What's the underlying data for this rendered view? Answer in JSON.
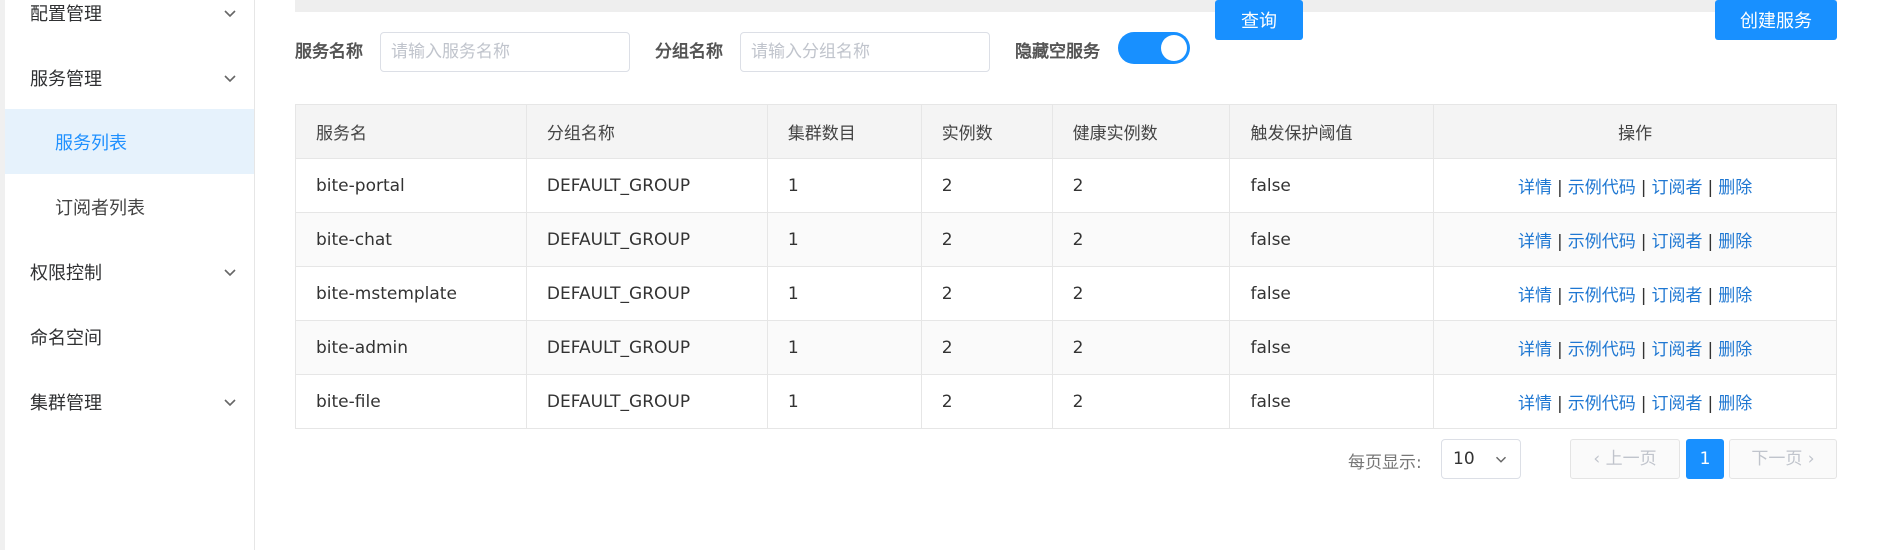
{
  "sidebar": {
    "items": [
      {
        "label": "配置管理",
        "expandable": true
      },
      {
        "label": "服务管理",
        "expandable": true
      },
      {
        "label": "服务列表",
        "sub": true,
        "active": true
      },
      {
        "label": "订阅者列表",
        "sub": true
      },
      {
        "label": "权限控制",
        "expandable": true
      },
      {
        "label": "命名空间",
        "expandable": false
      },
      {
        "label": "集群管理",
        "expandable": true
      }
    ]
  },
  "filter": {
    "service_name_label": "服务名称",
    "service_name_placeholder": "请输入服务名称",
    "service_name_value": "",
    "group_name_label": "分组名称",
    "group_name_placeholder": "请输入分组名称",
    "group_name_value": "",
    "hide_empty_label": "隐藏空服务",
    "hide_empty_on": true,
    "query_button": "查询",
    "create_button": "创建服务"
  },
  "table": {
    "headers": [
      "服务名",
      "分组名称",
      "集群数目",
      "实例数",
      "健康实例数",
      "触发保护阈值",
      "操作"
    ],
    "rows": [
      [
        "bite-portal",
        "DEFAULT_GROUP",
        "1",
        "2",
        "2",
        "false"
      ],
      [
        "bite-chat",
        "DEFAULT_GROUP",
        "1",
        "2",
        "2",
        "false"
      ],
      [
        "bite-mstemplate",
        "DEFAULT_GROUP",
        "1",
        "2",
        "2",
        "false"
      ],
      [
        "bite-admin",
        "DEFAULT_GROUP",
        "1",
        "2",
        "2",
        "false"
      ],
      [
        "bite-file",
        "DEFAULT_GROUP",
        "1",
        "2",
        "2",
        "false"
      ]
    ],
    "actions": [
      "详情",
      "示例代码",
      "订阅者",
      "删除"
    ],
    "action_separator": "|"
  },
  "pagination": {
    "page_size_label": "每页显示:",
    "page_size": "10",
    "prev": "上一页",
    "current_page": "1",
    "next": "下一页"
  },
  "colors": {
    "primary": "#1890ff",
    "link": "#1e77d2",
    "active_bg": "#e6f2fc"
  }
}
